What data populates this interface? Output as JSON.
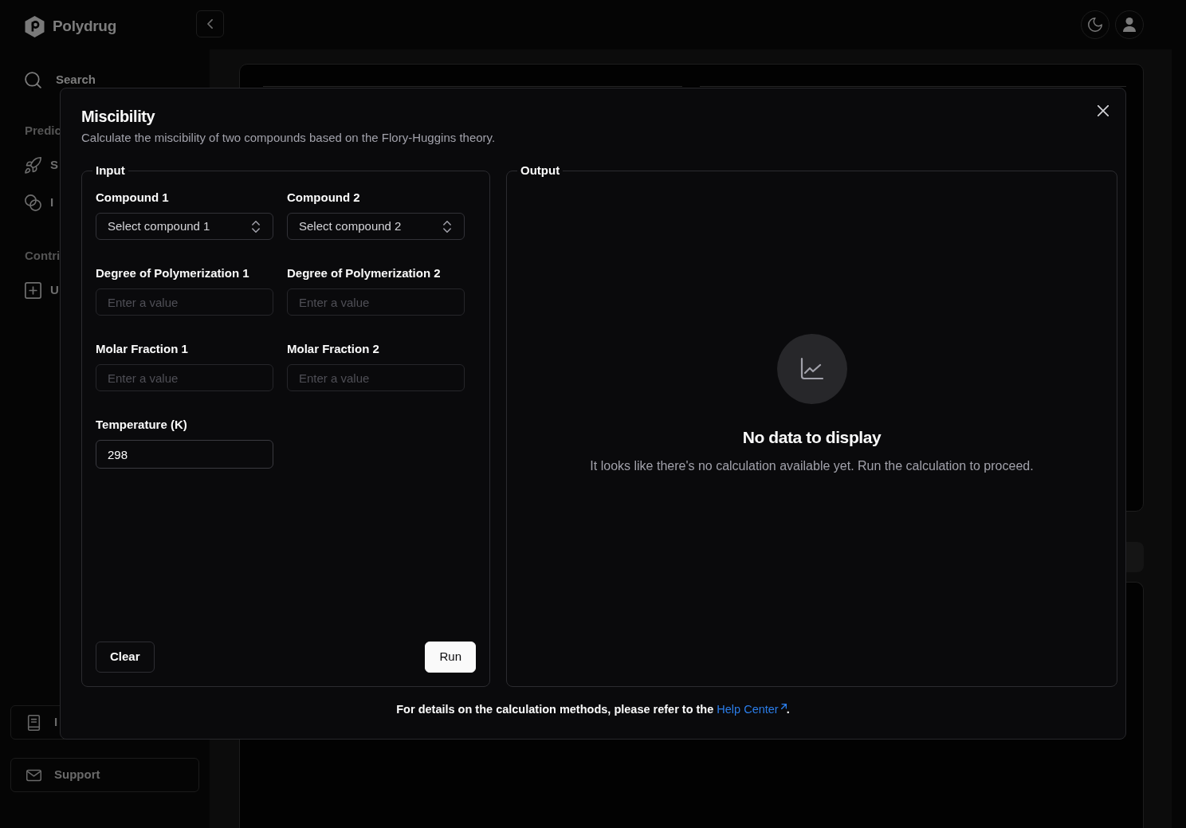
{
  "sidebar": {
    "brand": "Polydrug",
    "search": "Search",
    "sections": [
      {
        "title": "Predic",
        "items": [
          {
            "label": "S"
          },
          {
            "label": "I"
          }
        ]
      },
      {
        "title": "Contri",
        "items": [
          {
            "label": "U"
          }
        ]
      }
    ],
    "bottom_items": [
      {
        "label": "I"
      },
      {
        "label": "Support"
      }
    ]
  },
  "modal": {
    "title": "Miscibility",
    "description": "Calculate the miscibility of two compounds based on the Flory-Huggins theory.",
    "input": {
      "legend": "Input",
      "fields": [
        {
          "kind": "select",
          "label": "Compound 1",
          "placeholder": "Select compound 1"
        },
        {
          "kind": "select",
          "label": "Compound 2",
          "placeholder": "Select compound 2"
        },
        {
          "kind": "number",
          "label": "Degree of Polymerization 1",
          "placeholder": "Enter a value"
        },
        {
          "kind": "number",
          "label": "Degree of Polymerization 2",
          "placeholder": "Enter a value"
        },
        {
          "kind": "number",
          "label": "Molar Fraction 1",
          "placeholder": "Enter a value"
        },
        {
          "kind": "number",
          "label": "Molar Fraction 2",
          "placeholder": "Enter a value"
        },
        {
          "kind": "number",
          "label": "Temperature (K)",
          "value": "298"
        }
      ],
      "buttons": [
        {
          "kind": "reset",
          "label": "Clear"
        },
        {
          "kind": "submit",
          "label": "Run"
        }
      ]
    },
    "output": {
      "legend": "Output",
      "empty_title": "No data to display",
      "empty_text": "It looks like there's no calculation available yet. Run the calculation to proceed."
    },
    "footer": {
      "text": "For details on the calculation methods, please refer to the",
      "link": "Help Center",
      "after": "."
    }
  }
}
